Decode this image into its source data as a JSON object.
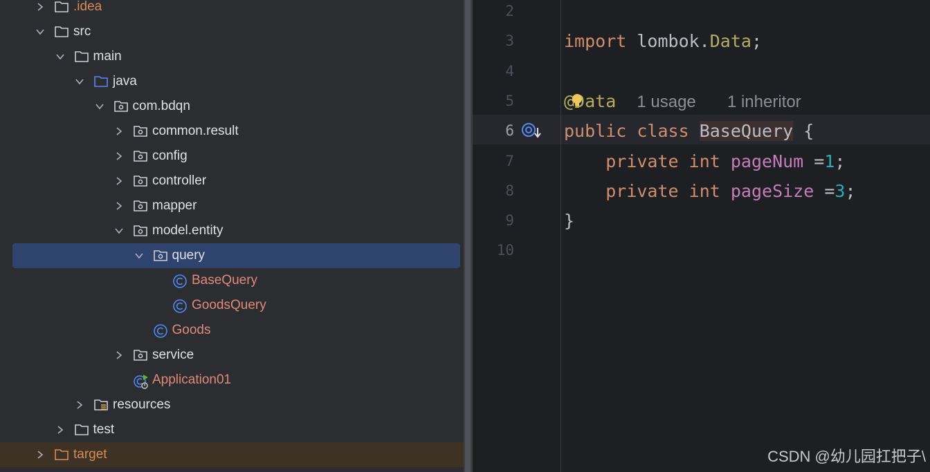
{
  "project_tree": {
    "items": [
      {
        "label": ".idea",
        "level": 0,
        "expanded": false,
        "icon": "folder-icon",
        "style": "idea"
      },
      {
        "label": "src",
        "level": 0,
        "expanded": true,
        "icon": "folder-icon"
      },
      {
        "label": "main",
        "level": 1,
        "expanded": true,
        "icon": "folder-icon"
      },
      {
        "label": "java",
        "level": 2,
        "expanded": true,
        "icon": "source-folder-icon"
      },
      {
        "label": "com.bdqn",
        "level": 3,
        "expanded": true,
        "icon": "package-icon"
      },
      {
        "label": "common.result",
        "level": 4,
        "expanded": false,
        "icon": "package-icon"
      },
      {
        "label": "config",
        "level": 4,
        "expanded": false,
        "icon": "package-icon"
      },
      {
        "label": "controller",
        "level": 4,
        "expanded": false,
        "icon": "package-icon"
      },
      {
        "label": "mapper",
        "level": 4,
        "expanded": false,
        "icon": "package-icon"
      },
      {
        "label": "model.entity",
        "level": 4,
        "expanded": true,
        "icon": "package-icon"
      },
      {
        "label": "query",
        "level": 5,
        "expanded": true,
        "icon": "package-icon",
        "selected": true
      },
      {
        "label": "BaseQuery",
        "level": 6,
        "icon": "class-icon",
        "leaf": true
      },
      {
        "label": "GoodsQuery",
        "level": 6,
        "icon": "class-icon",
        "leaf": true
      },
      {
        "label": "Goods",
        "level": 5,
        "icon": "class-icon",
        "leaf": true
      },
      {
        "label": "service",
        "level": 4,
        "expanded": false,
        "icon": "package-icon"
      },
      {
        "label": "Application01",
        "level": 4,
        "icon": "spring-app-icon",
        "leaf": true
      },
      {
        "label": "resources",
        "level": 2,
        "expanded": false,
        "icon": "resources-folder-icon"
      },
      {
        "label": "test",
        "level": 1,
        "expanded": false,
        "icon": "folder-icon"
      },
      {
        "label": "target",
        "level": 0,
        "expanded": false,
        "icon": "excluded-folder-icon",
        "excluded": true
      }
    ]
  },
  "editor": {
    "current_line": "6",
    "lines": [
      {
        "num": "2",
        "tokens": []
      },
      {
        "num": "3",
        "tokens": [
          {
            "t": "import",
            "c": "kw"
          },
          {
            "t": " lombok.",
            "c": ""
          },
          {
            "t": "Data",
            "c": "ann"
          },
          {
            "t": ";",
            "c": ""
          }
        ]
      },
      {
        "num": "4",
        "tokens": []
      },
      {
        "num": "5",
        "tokens": [
          {
            "t": "@Data",
            "c": "ann"
          },
          {
            "t": "  ",
            "c": ""
          },
          {
            "t": "1 usage",
            "c": "hint"
          },
          {
            "t": "   ",
            "c": ""
          },
          {
            "t": "1 inheritor",
            "c": "hint"
          }
        ]
      },
      {
        "num": "6",
        "tokens": [
          {
            "t": "public",
            "c": "kw"
          },
          {
            "t": " ",
            "c": ""
          },
          {
            "t": "class",
            "c": "kw"
          },
          {
            "t": " ",
            "c": ""
          },
          {
            "t": "BaseQuery",
            "c": "clsname"
          },
          {
            "t": " {",
            "c": ""
          }
        ]
      },
      {
        "num": "7",
        "tokens": [
          {
            "t": "    ",
            "c": ""
          },
          {
            "t": "private",
            "c": "kw"
          },
          {
            "t": " ",
            "c": ""
          },
          {
            "t": "int",
            "c": "kw"
          },
          {
            "t": " ",
            "c": ""
          },
          {
            "t": "pageNum",
            "c": "fld"
          },
          {
            "t": " =",
            "c": ""
          },
          {
            "t": "1",
            "c": "num"
          },
          {
            "t": ";",
            "c": ""
          }
        ]
      },
      {
        "num": "8",
        "tokens": [
          {
            "t": "    ",
            "c": ""
          },
          {
            "t": "private",
            "c": "kw"
          },
          {
            "t": " ",
            "c": ""
          },
          {
            "t": "int",
            "c": "kw"
          },
          {
            "t": " ",
            "c": ""
          },
          {
            "t": "pageSize",
            "c": "fld"
          },
          {
            "t": " =",
            "c": ""
          },
          {
            "t": "3",
            "c": "num"
          },
          {
            "t": ";",
            "c": ""
          }
        ]
      },
      {
        "num": "9",
        "tokens": [
          {
            "t": "}",
            "c": ""
          }
        ]
      },
      {
        "num": "10",
        "tokens": []
      }
    ]
  },
  "watermark": "CSDN @幼儿园扛把子\\",
  "colors": {
    "tree_bg": "#2b2d30",
    "editor_bg": "#1e1f22",
    "selection": "#2e436e",
    "keyword": "#cf8e6d",
    "annotation": "#b3ae60",
    "field": "#c77dbb",
    "number": "#2aacb8",
    "class_file": "#e08a7c",
    "excluded": "#d88c5a"
  }
}
